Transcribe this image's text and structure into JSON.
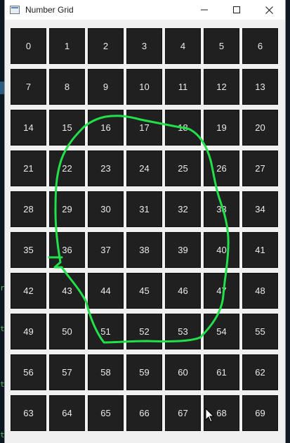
{
  "window": {
    "title": "Number Grid",
    "controls": [
      "minimize",
      "maximize",
      "close"
    ]
  },
  "grid": {
    "rows": 10,
    "columns": 7,
    "cells": [
      "0",
      "1",
      "2",
      "3",
      "4",
      "5",
      "6",
      "7",
      "8",
      "9",
      "10",
      "11",
      "12",
      "13",
      "14",
      "15",
      "16",
      "17",
      "18",
      "19",
      "20",
      "21",
      "22",
      "23",
      "24",
      "25",
      "26",
      "27",
      "28",
      "29",
      "30",
      "31",
      "32",
      "33",
      "34",
      "35",
      "36",
      "37",
      "38",
      "39",
      "40",
      "41",
      "42",
      "43",
      "44",
      "45",
      "46",
      "47",
      "48",
      "49",
      "50",
      "51",
      "52",
      "53",
      "54",
      "55",
      "56",
      "57",
      "58",
      "59",
      "60",
      "61",
      "62",
      "63",
      "64",
      "65",
      "66",
      "67",
      "68",
      "69"
    ]
  },
  "annotation": {
    "type": "freehand-lasso",
    "color": "#22e04a",
    "encircled_cells": [
      "16",
      "17",
      "18",
      "22",
      "23",
      "24",
      "25",
      "26",
      "29",
      "30",
      "31",
      "32",
      "33",
      "36",
      "37",
      "38",
      "39",
      "40",
      "43",
      "44",
      "45",
      "46",
      "47",
      "51",
      "52",
      "53"
    ]
  },
  "colors": {
    "cell_background": "#202020",
    "cell_text": "#eaeaea",
    "window_background": "#f0f0f0"
  },
  "background_glyphs": [
    "r",
    "t",
    "t",
    "t"
  ],
  "icons": {
    "app": "window-app-icon",
    "minimize": "minimize-icon",
    "maximize": "maximize-icon",
    "close": "close-icon",
    "pointer": "mouse-pointer-icon"
  }
}
